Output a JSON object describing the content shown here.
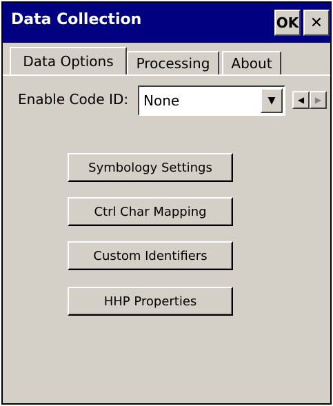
{
  "window": {
    "title": "Data Collection",
    "ok_label": "OK",
    "close_glyph": "✕"
  },
  "tabs": [
    {
      "label": "Data Options",
      "selected": true
    },
    {
      "label": "Processing",
      "selected": false
    },
    {
      "label": "About",
      "selected": false
    }
  ],
  "tab_scroll": {
    "left_glyph": "◀",
    "right_glyph": "▶"
  },
  "code_id": {
    "label": "Enable Code ID:",
    "value": "None",
    "dropdown_glyph": "▼"
  },
  "buttons": {
    "symbology": "Symbology Settings",
    "ctrl_char": "Ctrl Char Mapping",
    "custom_ids": "Custom Identifiers",
    "hhp_props": "HHP Properties"
  },
  "colors": {
    "titlebar": "#000080",
    "face": "#d4d0c8"
  }
}
